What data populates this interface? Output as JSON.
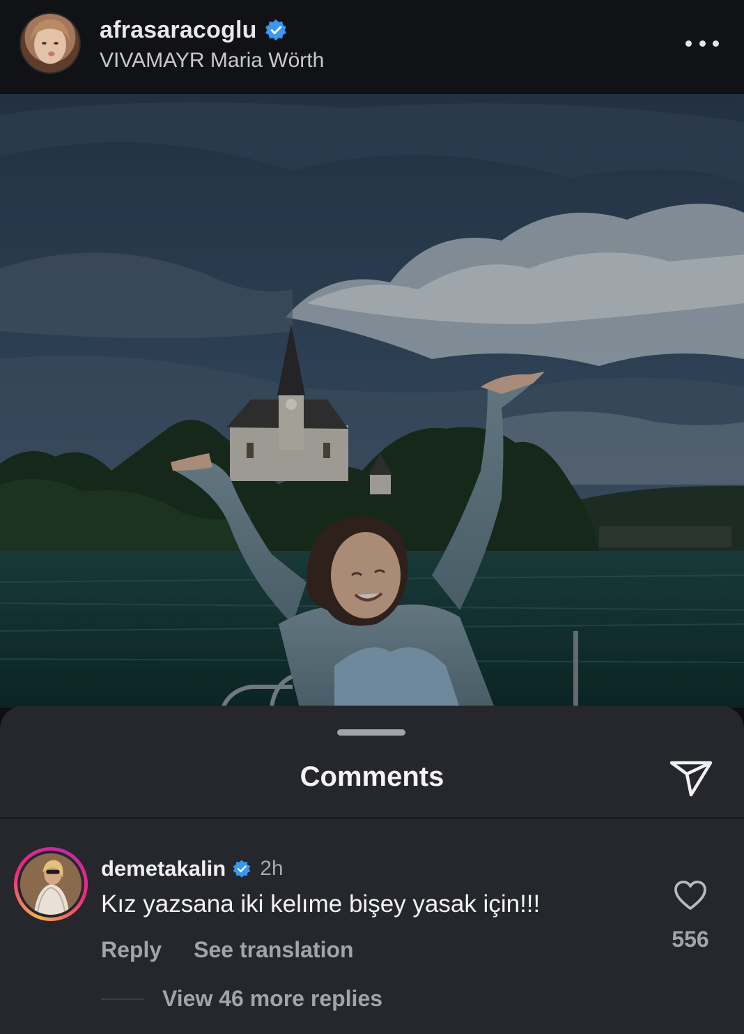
{
  "post": {
    "username": "afrasaracoglu",
    "location": "VIVAMAYR Maria Wörth",
    "verified": true,
    "more_icon": "more-horizontal-icon"
  },
  "comments_sheet": {
    "title": "Comments",
    "share_icon": "send-icon"
  },
  "comment": {
    "username": "demetakalin",
    "verified": true,
    "time": "2h",
    "text": "Kız yazsana iki kelıme bişey yasak için!!!",
    "reply_label": "Reply",
    "translate_label": "See translation",
    "like_icon": "heart-outline-icon",
    "like_count": "556",
    "view_replies_label": "View 46 more replies"
  },
  "colors": {
    "background": "#111216",
    "sheet": "#25272d",
    "verified_blue": "#3897f0",
    "muted_text": "#a3a4a9"
  }
}
